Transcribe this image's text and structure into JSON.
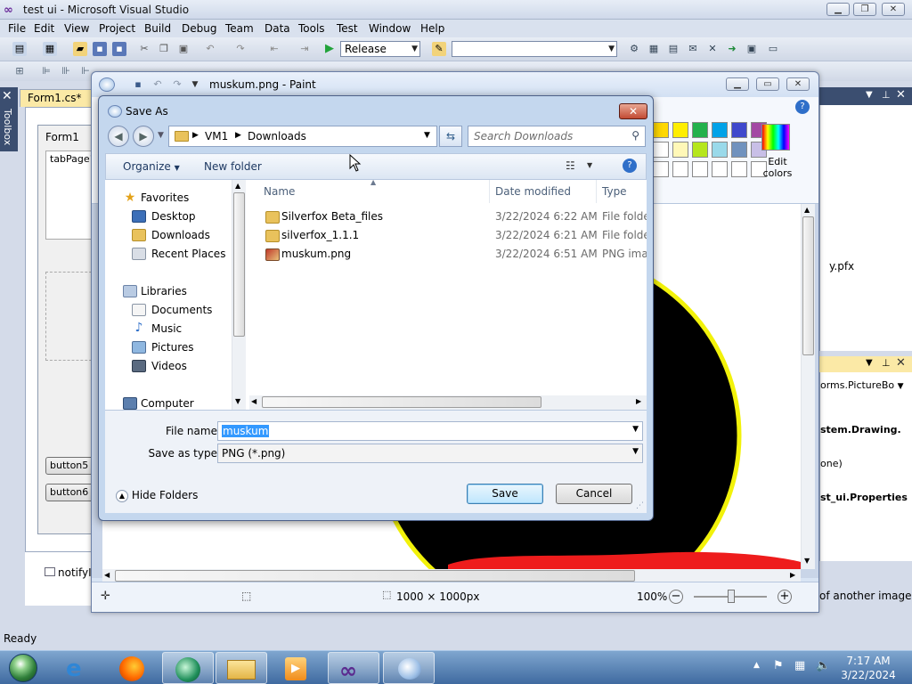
{
  "vs": {
    "title": "test ui - Microsoft Visual Studio",
    "menu": [
      "File",
      "Edit",
      "View",
      "Project",
      "Build",
      "Debug",
      "Team",
      "Data",
      "Tools",
      "Test",
      "Window",
      "Help"
    ],
    "config_combo": "Release",
    "toolbox_label": "Toolbox",
    "doc_tab": "Form1.cs*",
    "form_title": "Form1",
    "tab_page": "tabPage1",
    "button_a": "button5",
    "button_b": "button6",
    "tray_item": "notifyI",
    "status": "Ready",
    "right_panel_text": "y.pfx",
    "props_combo": "orms.PictureBo",
    "prop_rows": [
      "stem.Drawing.",
      "one)",
      "st_ui.Properties"
    ],
    "prop_hint": "of another image"
  },
  "paint": {
    "title": "muskum.png - Paint",
    "edit_colors": "Edit colors",
    "dimensions": "1000 × 1000px",
    "zoom": "100%",
    "palette": [
      "#ffd800",
      "#ffee00",
      "#22b14c",
      "#00a2e8",
      "#3f48cc",
      "#a349a4"
    ],
    "palette2": [
      "#ffffff",
      "#fff8b8",
      "#b5e61d",
      "#99d9ea",
      "#7092be",
      "#c8bfe7"
    ]
  },
  "dialog": {
    "title": "Save As",
    "breadcrumb": [
      "VM1",
      "Downloads"
    ],
    "search_placeholder": "Search Downloads",
    "organize": "Organize",
    "new_folder": "New folder",
    "nav": {
      "favorites": "Favorites",
      "favorites_items": [
        "Desktop",
        "Downloads",
        "Recent Places"
      ],
      "libraries": "Libraries",
      "libraries_items": [
        "Documents",
        "Music",
        "Pictures",
        "Videos"
      ],
      "computer": "Computer"
    },
    "columns": {
      "name": "Name",
      "date": "Date modified",
      "type": "Type"
    },
    "files": [
      {
        "name": "Silverfox Beta_files",
        "date": "3/22/2024 6:22 AM",
        "type": "File folder",
        "kind": "folder"
      },
      {
        "name": "silverfox_1.1.1",
        "date": "3/22/2024 6:21 AM",
        "type": "File folder",
        "kind": "folder"
      },
      {
        "name": "muskum.png",
        "date": "3/22/2024 6:51 AM",
        "type": "PNG imag",
        "kind": "png"
      }
    ],
    "file_name_label": "File name:",
    "file_name_value": "muskum",
    "save_type_label": "Save as type:",
    "save_type_value": "PNG (*.png)",
    "hide_folders": "Hide Folders",
    "save": "Save",
    "cancel": "Cancel"
  },
  "taskbar": {
    "time": "7:17 AM",
    "date": "3/22/2024"
  }
}
